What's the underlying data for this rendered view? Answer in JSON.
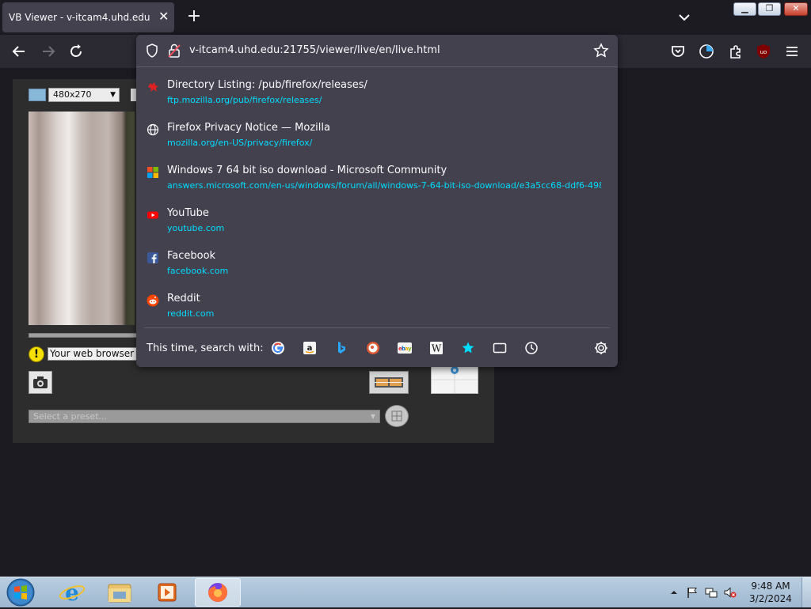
{
  "tab": {
    "title": "VB Viewer - v-itcam4.uhd.edu",
    "close": "✕"
  },
  "new_tab": "+",
  "window_controls": {
    "minimize": "▁",
    "maximize": "❐",
    "close": "✕"
  },
  "urlbar": {
    "url": "v-itcam4.uhd.edu:21755/viewer/live/en/live.html"
  },
  "suggestions": [
    {
      "title": "Directory Listing: /pub/firefox/releases/",
      "url": "ftp.mozilla.org/pub/firefox/releases/",
      "icon": "mozilla-dino-icon"
    },
    {
      "title": "Firefox Privacy Notice — Mozilla",
      "url": "mozilla.org/en-US/privacy/firefox/",
      "icon": "globe-icon"
    },
    {
      "title": "Windows 7 64 bit iso download - Microsoft Community",
      "url": "answers.microsoft.com/en-us/windows/forum/all/windows-7-64-bit-iso-download/e3a5cc68-ddf6-498",
      "icon": "microsoft-icon"
    },
    {
      "title": "YouTube",
      "url": "youtube.com",
      "icon": "youtube-icon"
    },
    {
      "title": "Facebook",
      "url": "facebook.com",
      "icon": "facebook-icon"
    },
    {
      "title": "Reddit",
      "url": "reddit.com",
      "icon": "reddit-icon"
    }
  ],
  "oneoff": {
    "label": "This time, search with:",
    "engines": [
      "google-icon",
      "amazon-icon",
      "bing-icon",
      "duckduckgo-icon",
      "ebay-icon",
      "wikipedia-icon",
      "bookmarks-icon",
      "tabs-icon",
      "history-icon"
    ]
  },
  "viewer": {
    "resolution": "480x270",
    "warning": "Your web browser is n",
    "preset_placeholder": "Select a preset..."
  },
  "clock": {
    "time": "9:48 AM",
    "date": "3/2/2024"
  },
  "colors": {
    "accent_link": "#00ddff",
    "panel_bg": "#42414d",
    "toolbar_bg": "#2b2a33"
  }
}
